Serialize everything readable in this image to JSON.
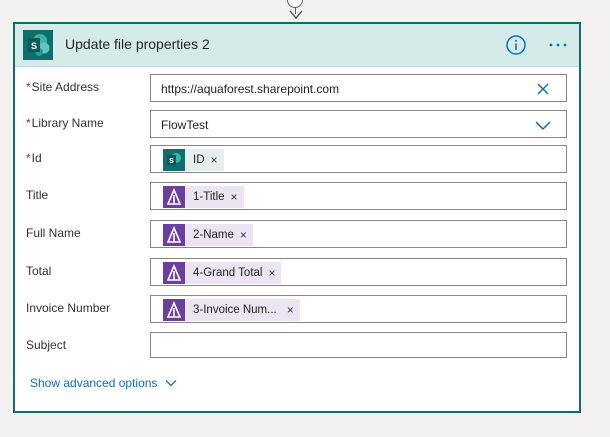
{
  "card": {
    "title": "Update file properties 2",
    "accent_color": "#0f6d6b",
    "header_color": "#d5ebea",
    "logo_icon": "sharepoint-logo-icon",
    "info_icon": "info-icon",
    "more_icon": "more-options-icon"
  },
  "fields": {
    "site_address": {
      "label": "Site Address",
      "required": "*",
      "value": "https://aquaforest.sharepoint.com"
    },
    "library_name": {
      "label": "Library Name",
      "required": "*",
      "value": "FlowTest"
    },
    "id": {
      "label": "Id",
      "required": "*",
      "token": "ID"
    },
    "title": {
      "label": "Title",
      "token": "1-Title"
    },
    "full_name": {
      "label": "Full Name",
      "token": "2-Name"
    },
    "total": {
      "label": "Total",
      "token": "4-Grand Total"
    },
    "invoice_number": {
      "label": "Invoice Number",
      "token": "3-Invoice Num..."
    },
    "subject": {
      "label": "Subject",
      "value": ""
    }
  },
  "token_remove_glyph": "×",
  "advanced": {
    "label": "Show advanced options"
  }
}
